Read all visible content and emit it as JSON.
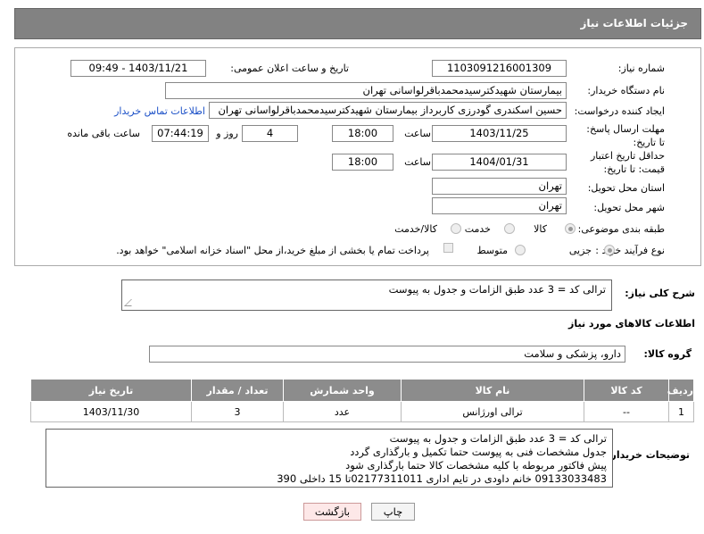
{
  "header": {
    "title": "جزئیات اطلاعات نیاز"
  },
  "fields": {
    "need_number_label": "شماره نیاز:",
    "need_number": "1103091216001309",
    "announce_label": "تاریخ و ساعت اعلان عمومی:",
    "announce_value": "1403/11/21 - 09:49",
    "buyer_org_label": "نام دستگاه خریدار:",
    "buyer_org": "بیمارستان شهیدکترسیدمحمدباقرلواسانی تهران",
    "creator_label": "ایجاد کننده درخواست:",
    "creator": "حسین اسکندری گودرزی کاربرداز بیمارستان شهیدکترسیدمحمدباقرلواسانی تهران",
    "contact_link": "اطلاعات تماس خریدار",
    "deadline_label": "مهلت ارسال پاسخ: تا تاریخ:",
    "deadline_date": "1403/11/25",
    "time_word": "ساعت",
    "deadline_time": "18:00",
    "days_value": "4",
    "days_word": "روز و",
    "remaining_time": "07:44:19",
    "remaining_word": "ساعت باقی مانده",
    "price_validity_label": "حداقل تاریخ اعتبار قیمت: تا تاریخ:",
    "price_validity_date": "1404/01/31",
    "price_validity_time": "18:00",
    "province_label": "استان محل تحویل:",
    "province": "تهران",
    "city_label": "شهر محل تحویل:",
    "city": "تهران",
    "category_label": "طبقه بندی موضوعی:",
    "category_options": [
      "کالا",
      "خدمت",
      "کالا/خدمت"
    ],
    "process_label": "نوع فرآیند خرید :",
    "process_options": [
      "جزیی",
      "متوسط"
    ],
    "payment_note": "پرداخت تمام یا بخشی از مبلغ خرید،از محل \"اسناد خزانه اسلامی\" خواهد بود."
  },
  "description": {
    "label": "شرح کلی نیاز:",
    "value": "ترالی کد = 3 عدد طبق الزامات و جدول به پیوست"
  },
  "goods": {
    "section_title": "اطلاعات کالاهای مورد نیاز",
    "group_label": "گروه کالا:",
    "group_value": "دارو، پزشکی و سلامت",
    "columns": [
      "ردیف",
      "کد کالا",
      "نام کالا",
      "واحد شمارش",
      "تعداد / مقدار",
      "تاریخ نیاز"
    ],
    "rows": [
      {
        "row": "1",
        "code": "--",
        "name": "ترالی اورژانس",
        "unit": "عدد",
        "qty": "3",
        "date": "1403/11/30"
      }
    ]
  },
  "buyer_notes": {
    "label": "توضیحات خریدار:",
    "lines": [
      "ترالی کد = 3 عدد طبق الزامات و جدول به پیوست",
      "جدول مشخصات فنی به پیوست حتما تکمیل و بارگذاری گردد",
      "پیش فاکتور مربوطه با کلیه مشخصات کالا حتما بارگذاری شود",
      "09133033483 خانم داودی در تایم اداری 02177311011تا 15 داخلی 390"
    ]
  },
  "buttons": {
    "print": "چاپ",
    "back": "بازگشت"
  }
}
